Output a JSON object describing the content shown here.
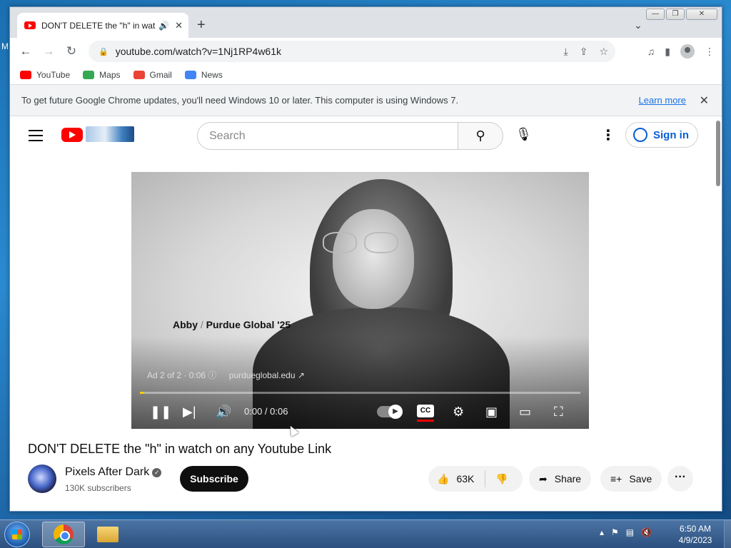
{
  "desktop": {
    "edge_letter": "M"
  },
  "browser": {
    "tab": {
      "title": "DON'T DELETE the \"h\" in wat",
      "audio_icon": "speaker-icon",
      "close": "✕"
    },
    "new_tab": "+",
    "tab_search": "⌄",
    "window_controls": {
      "minimize": "—",
      "restore": "❐",
      "close": "✕"
    },
    "nav": {
      "back": "←",
      "forward": "→",
      "reload": "↻"
    },
    "url": "youtube.com/watch?v=1Nj1RP4w61k",
    "bookmarks": [
      {
        "label": "YouTube",
        "icon": "youtube-icon",
        "color": "#ff0000"
      },
      {
        "label": "Maps",
        "icon": "maps-icon",
        "color": "#34a853"
      },
      {
        "label": "Gmail",
        "icon": "gmail-icon",
        "color": "#ea4335"
      },
      {
        "label": "News",
        "icon": "news-icon",
        "color": "#4285f4"
      }
    ],
    "infobar": {
      "message": "To get future Google Chrome updates, you'll need Windows 10 or later. This computer is using Windows 7.",
      "learn_more": "Learn more",
      "close": "✕"
    }
  },
  "youtube": {
    "search_placeholder": "Search",
    "sign_in": "Sign in",
    "video": {
      "caption_name": "Abby",
      "caption_sep": " / ",
      "caption_school": "Purdue Global '25",
      "ad_label": "Ad 2 of 2 · 0:06",
      "ad_domain": "purdueglobal.edu",
      "time": "0:00 / 0:06",
      "cc": "CC",
      "progress": 0.01
    },
    "title": "DON'T DELETE the \"h\" in watch on any Youtube Link",
    "channel": {
      "name": "Pixels After Dark",
      "subscribers": "130K subscribers"
    },
    "subscribe": "Subscribe",
    "likes": "63K",
    "share": "Share",
    "save": "Save"
  },
  "taskbar": {
    "time": "6:50 AM",
    "date": "4/9/2023"
  },
  "colors": {
    "youtube_red": "#ff0000",
    "link_blue": "#065fd4",
    "chrome_blue": "#1a73e8"
  }
}
